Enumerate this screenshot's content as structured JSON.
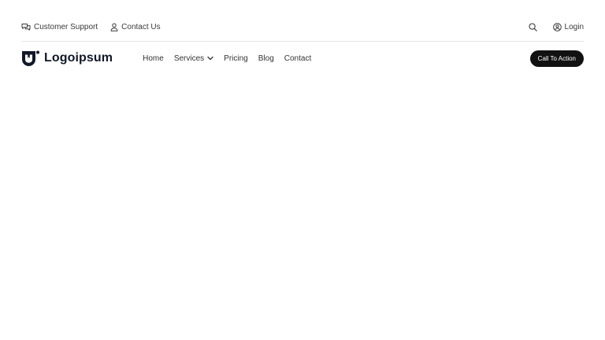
{
  "topbar": {
    "left_links": [
      {
        "label": "Customer Support",
        "icon": "chat-bubbles-icon"
      },
      {
        "label": "Contact Us",
        "icon": "user-icon"
      }
    ],
    "search_icon": "search-icon",
    "login": {
      "label": "Login",
      "icon": "user-circle-icon"
    }
  },
  "navbar": {
    "logo_text": "Logoipsum",
    "logo_icon": "shield-logo-icon",
    "menu": [
      {
        "label": "Home"
      },
      {
        "label": "Services",
        "icon": "chevron-down-icon"
      },
      {
        "label": "Pricing"
      },
      {
        "label": "Blog"
      },
      {
        "label": "Contact"
      }
    ],
    "cta_label": "Call To Action"
  },
  "colors": {
    "background": "#ffffff",
    "text": "#2b2b2b",
    "logo": "#111827",
    "cta_background": "#111111",
    "cta_text": "#ffffff",
    "divider": "#e7e7e7"
  }
}
